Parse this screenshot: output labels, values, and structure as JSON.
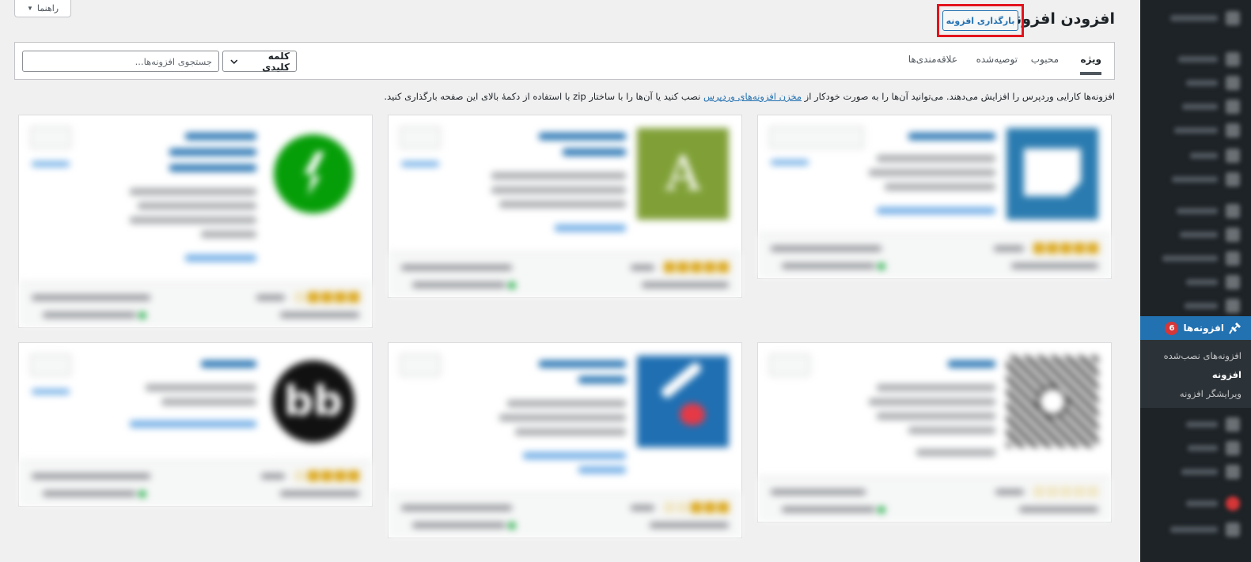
{
  "header": {
    "title": "افزودن افزونه",
    "upload_label": "بارگذاری افزونه",
    "help_label": "راهنما"
  },
  "filter": {
    "tabs": [
      "ویژه",
      "محبوب",
      "توصیه‌شده",
      "علاقه‌مندی‌ها"
    ],
    "active_tab": "ویژه",
    "search_type": "کلمه کلیدی",
    "search_placeholder": "جستجوی افزونه‌ها..."
  },
  "description": {
    "before_link": "افزونه‌ها کارایی وردپرس را افزایش می‌دهند. می‌توانید آن‌ها را به صورت خودکار از ",
    "link": "مخزن افزونه‌های وردپرس",
    "after_link": " نصب کنید یا آن‌ها را با ساختار zip با استفاده از دکمهٔ بالای این صفحه بارگذاری کنید."
  },
  "sidebar": {
    "plugins_label": "افزونه‌ها",
    "plugins_count": "6",
    "submenu": [
      "افزونه‌های نصب‌شده",
      "افزونه",
      "ویرایشگر افزونه"
    ],
    "current_submenu": "افزونه"
  },
  "colors": {
    "accent": "#2271b1",
    "sidebar_bg": "#1d2327",
    "highlight_box": "#e3141d",
    "badge": "#d63638",
    "star": "#dba617"
  },
  "icons": {
    "help_toggle": "triangle-down-icon",
    "search_type_toggle": "chevron-down-icon",
    "plugins_menu": "plug-icon"
  }
}
